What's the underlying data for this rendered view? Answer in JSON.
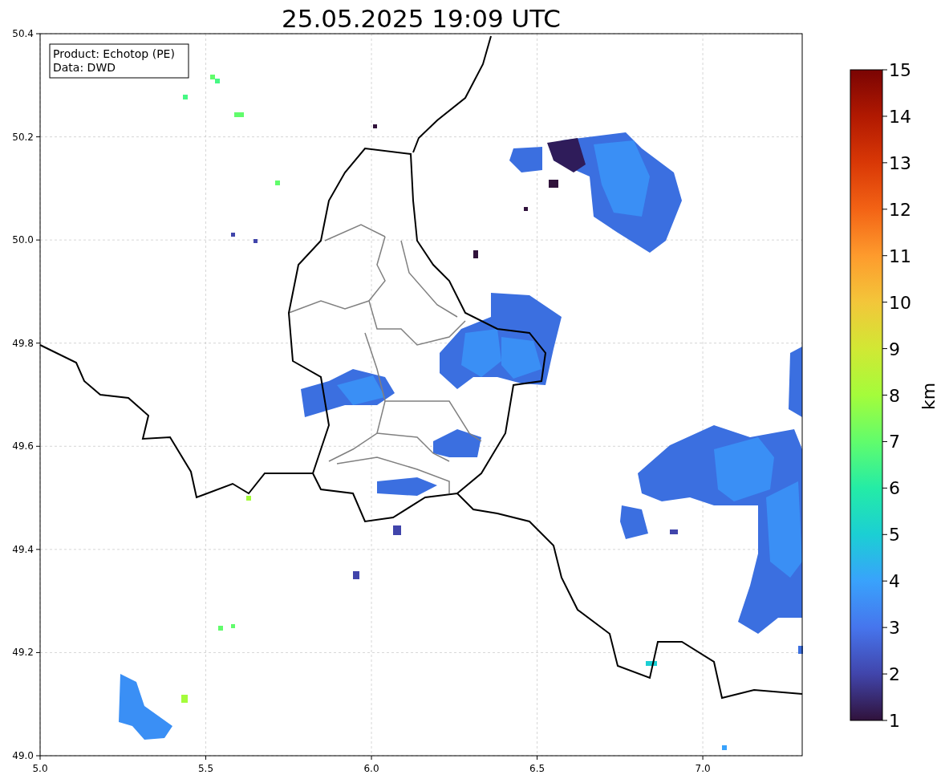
{
  "title": "25.05.2025 19:09 UTC",
  "info_box": [
    "Product: Echotop (PE)",
    "Data: DWD"
  ],
  "x_ticks": [
    "5.0",
    "5.5",
    "6.0",
    "6.5",
    "7.0"
  ],
  "y_ticks": [
    "50.4",
    "50.2",
    "50.0",
    "49.8",
    "49.6",
    "49.4",
    "49.2",
    "49.0"
  ],
  "colorbar": {
    "label": "km",
    "ticks": [
      "15",
      "14",
      "13",
      "12",
      "11",
      "10",
      "9",
      "8",
      "7",
      "6",
      "5",
      "4",
      "3",
      "2",
      "1"
    ]
  }
}
